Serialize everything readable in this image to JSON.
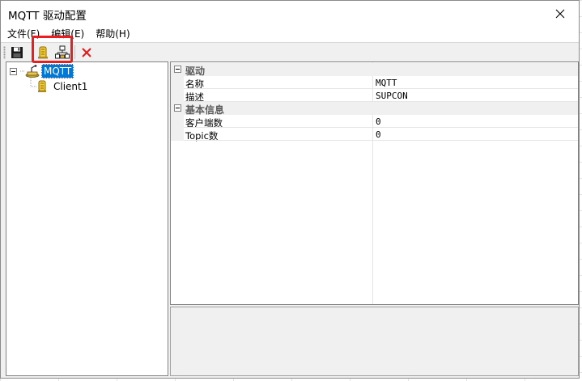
{
  "window": {
    "title": "MQTT 驱动配置"
  },
  "menu": {
    "items": [
      {
        "label": "文件(F)"
      },
      {
        "label": "编辑(E)"
      },
      {
        "label": "帮助(H)"
      }
    ]
  },
  "toolbar": {
    "buttons": [
      {
        "icon": "save-icon"
      },
      {
        "icon": "add-client-icon"
      },
      {
        "icon": "add-topic-icon"
      },
      {
        "icon": "delete-icon"
      }
    ],
    "highlight_color": "#ea1e1e"
  },
  "tree": {
    "root": {
      "label": "MQTT",
      "expander": "⊟"
    },
    "children": [
      {
        "label": "Client1"
      }
    ]
  },
  "properties": {
    "categories": [
      {
        "label": "驱动",
        "rows": [
          {
            "name": "名称",
            "value": "MQTT"
          },
          {
            "name": "描述",
            "value": "SUPCON"
          }
        ]
      },
      {
        "label": "基本信息",
        "rows": [
          {
            "name": "客户端数",
            "value": "0"
          },
          {
            "name": "Topic数",
            "value": "0"
          }
        ]
      }
    ]
  },
  "colors": {
    "selection": "#0078d7",
    "window_bg": "#f0f0f0"
  }
}
